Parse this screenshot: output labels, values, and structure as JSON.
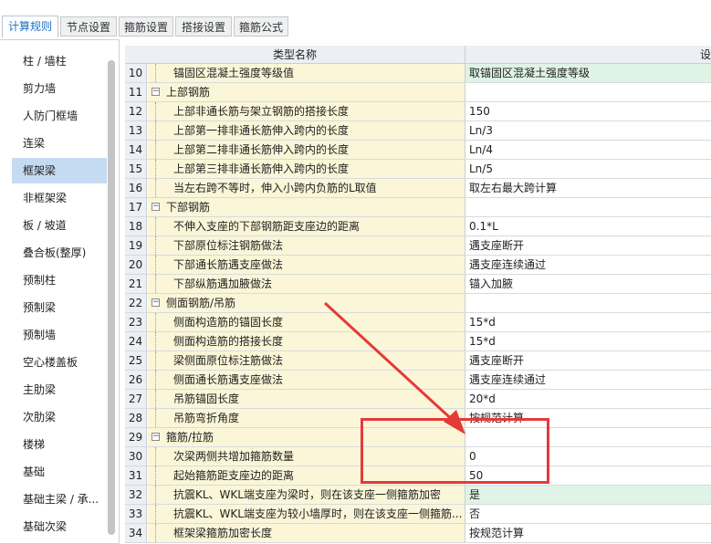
{
  "tabs": [
    "计算规则",
    "节点设置",
    "箍筋设置",
    "搭接设置",
    "箍筋公式"
  ],
  "active_tab": 0,
  "sidebar": {
    "items": [
      "柱 / 墙柱",
      "剪力墙",
      "人防门框墙",
      "连梁",
      "框架梁",
      "非框架梁",
      "板 / 坡道",
      "叠合板(整厚)",
      "预制柱",
      "预制梁",
      "预制墙",
      "空心楼盖板",
      "主肋梁",
      "次肋梁",
      "楼梯",
      "基础",
      "基础主梁 / 承...",
      "基础次梁"
    ],
    "selected": 4
  },
  "grid": {
    "header_name": "类型名称",
    "header_value": "设",
    "rows": [
      {
        "num": "10",
        "name": "锚固区混凝土强度等级值",
        "value": "取锚固区混凝土强度等级",
        "group": false,
        "highlight": true
      },
      {
        "num": "11",
        "name": "上部钢筋",
        "value": "",
        "group": true
      },
      {
        "num": "12",
        "name": "上部非通长筋与架立钢筋的搭接长度",
        "value": "150",
        "group": false
      },
      {
        "num": "13",
        "name": "上部第一排非通长筋伸入跨内的长度",
        "value": "Ln/3",
        "group": false
      },
      {
        "num": "14",
        "name": "上部第二排非通长筋伸入跨内的长度",
        "value": "Ln/4",
        "group": false
      },
      {
        "num": "15",
        "name": "上部第三排非通长筋伸入跨内的长度",
        "value": "Ln/5",
        "group": false
      },
      {
        "num": "16",
        "name": "当左右跨不等时，伸入小跨内负筋的L取值",
        "value": "取左右最大跨计算",
        "group": false
      },
      {
        "num": "17",
        "name": "下部钢筋",
        "value": "",
        "group": true
      },
      {
        "num": "18",
        "name": "不伸入支座的下部钢筋距支座边的距离",
        "value": "0.1*L",
        "group": false
      },
      {
        "num": "19",
        "name": "下部原位标注钢筋做法",
        "value": "遇支座断开",
        "group": false
      },
      {
        "num": "20",
        "name": "下部通长筋遇支座做法",
        "value": "遇支座连续通过",
        "group": false
      },
      {
        "num": "21",
        "name": "下部纵筋遇加腋做法",
        "value": "锚入加腋",
        "group": false
      },
      {
        "num": "22",
        "name": "侧面钢筋/吊筋",
        "value": "",
        "group": true
      },
      {
        "num": "23",
        "name": "侧面构造筋的锚固长度",
        "value": "15*d",
        "group": false
      },
      {
        "num": "24",
        "name": "侧面构造筋的搭接长度",
        "value": "15*d",
        "group": false
      },
      {
        "num": "25",
        "name": "梁侧面原位标注筋做法",
        "value": "遇支座断开",
        "group": false
      },
      {
        "num": "26",
        "name": "侧面通长筋遇支座做法",
        "value": "遇支座连续通过",
        "group": false
      },
      {
        "num": "27",
        "name": "吊筋锚固长度",
        "value": "20*d",
        "group": false
      },
      {
        "num": "28",
        "name": "吊筋弯折角度",
        "value": "按规范计算",
        "group": false
      },
      {
        "num": "29",
        "name": "箍筋/拉筋",
        "value": "",
        "group": true
      },
      {
        "num": "30",
        "name": "次梁两侧共增加箍筋数量",
        "value": "0",
        "group": false
      },
      {
        "num": "31",
        "name": "起始箍筋距支座边的距离",
        "value": "50",
        "group": false
      },
      {
        "num": "32",
        "name": "抗震KL、WKL端支座为梁时，则在该支座一侧箍筋加密",
        "value": "是",
        "group": false,
        "highlight": true
      },
      {
        "num": "33",
        "name": "抗震KL、WKL端支座为较小墙厚时，则在该支座一侧箍筋...",
        "value": "否",
        "group": false
      },
      {
        "num": "34",
        "name": "框架梁箍筋加密长度",
        "value": "按规范计算",
        "group": false
      }
    ]
  },
  "colors": {
    "annotation": "#e53a3a",
    "selected_sidebar": "#c5dbf2",
    "name_cell": "#fbf6d8",
    "value_highlight": "#dff3e6"
  }
}
